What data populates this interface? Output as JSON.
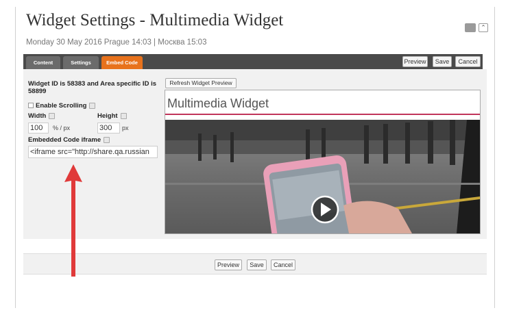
{
  "header": {
    "title": "Widget Settings - Multimedia Widget",
    "date_line": "Monday 30 May 2016 Prague 14:03 | Москва 15:03"
  },
  "tabs": [
    {
      "label": "Content",
      "active": false
    },
    {
      "label": "Settings",
      "active": false
    },
    {
      "label": "Embed Code",
      "active": true
    }
  ],
  "toolbar": {
    "preview_label": "Preview",
    "save_label": "Save",
    "cancel_label": "Cancel"
  },
  "form": {
    "widget_id_text": "Widget ID is 58383 and Area specific ID is 58899",
    "enable_scrolling_label": "Enable Scrolling",
    "enable_scrolling_checked": false,
    "width_label": "Width",
    "width_value": "100",
    "width_unit": "% / px",
    "height_label": "Height",
    "height_value": "300",
    "height_unit": "px",
    "embedded_code_label": "Embedded Code iframe",
    "embedded_code_value": "<iframe src=\"http://share.qa.russian"
  },
  "preview": {
    "refresh_label": "Refresh Widget Preview",
    "widget_title": "Multimedia Widget",
    "accent_color": "#c0345a"
  },
  "bottom": {
    "preview_label": "Preview",
    "save_label": "Save",
    "cancel_label": "Cancel"
  },
  "annotation": {
    "arrow_color": "#e03a3a"
  },
  "icons": [
    "help-icon",
    "play-icon",
    "collapse-chevron-icon"
  ]
}
